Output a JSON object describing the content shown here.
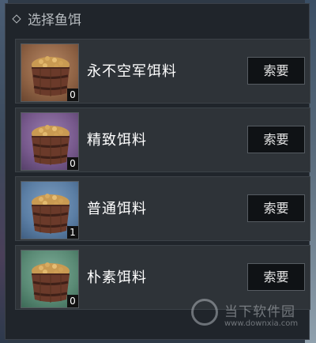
{
  "panel": {
    "title": "选择鱼饵",
    "items": [
      {
        "name": "永不空军饵料",
        "quantity": "0",
        "rarity_color": "#8e6244",
        "button_label": "索要"
      },
      {
        "name": "精致饵料",
        "quantity": "0",
        "rarity_color": "#77598c",
        "button_label": "索要"
      },
      {
        "name": "普通饵料",
        "quantity": "1",
        "rarity_color": "#5b7ea4",
        "button_label": "索要"
      },
      {
        "name": "朴素饵料",
        "quantity": "0",
        "rarity_color": "#5a8a75",
        "button_label": "索要"
      }
    ]
  },
  "watermark": {
    "text": "当下软件园",
    "url": "www.downxia.com"
  }
}
